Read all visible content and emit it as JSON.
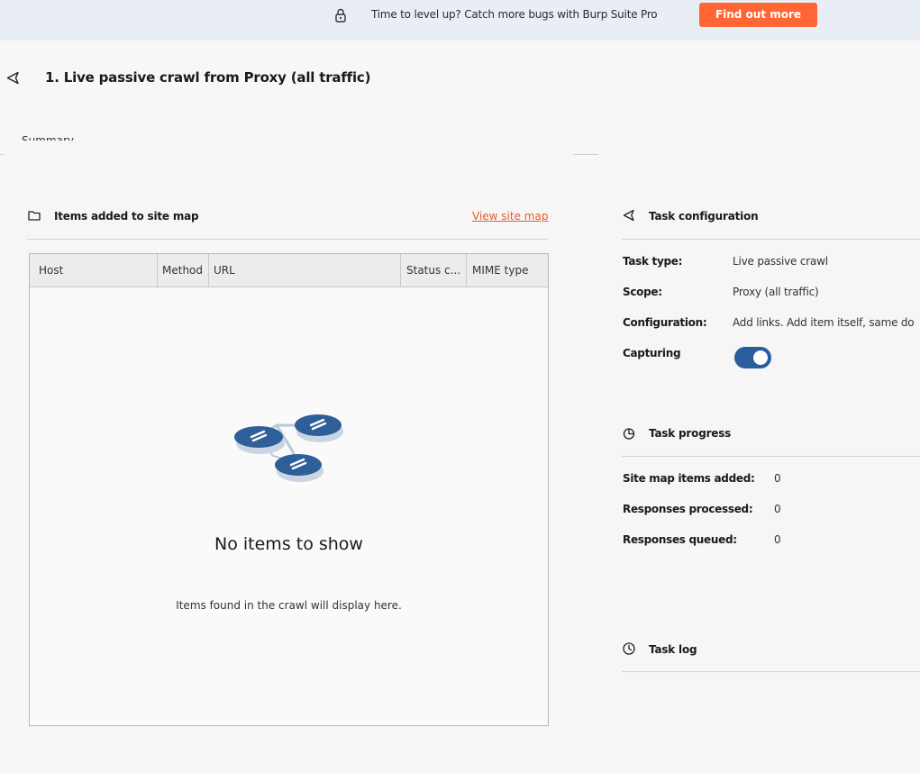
{
  "banner": {
    "message": "Time to level up? Catch more bugs with Burp Suite Pro",
    "cta_label": "Find out more"
  },
  "header": {
    "title": "1. Live passive crawl from Proxy (all traffic)"
  },
  "tabs": [
    {
      "label": "Summary",
      "active": true
    }
  ],
  "site_map_panel": {
    "title": "Items added to site map",
    "link_label": "View site map",
    "columns": [
      "Host",
      "Method",
      "URL",
      "Status c...",
      "MIME type"
    ],
    "rows": [],
    "empty_title": "No items to show",
    "empty_subtitle": "Items found in the crawl will display here."
  },
  "task_configuration": {
    "title": "Task configuration",
    "fields": [
      {
        "label": "Task type:",
        "value": "Live passive crawl"
      },
      {
        "label": "Scope:",
        "value": "Proxy (all traffic)"
      },
      {
        "label": "Configuration:",
        "value": "Add links. Add item itself, same do"
      },
      {
        "label": "Capturing",
        "value": ""
      }
    ],
    "capturing_enabled": true
  },
  "task_progress": {
    "title": "Task progress",
    "fields": [
      {
        "label": "Site map items added:",
        "value": "0"
      },
      {
        "label": "Responses processed:",
        "value": "0"
      },
      {
        "label": "Responses queued:",
        "value": "0"
      }
    ]
  },
  "task_log": {
    "title": "Task log"
  },
  "colors": {
    "accent": "#ff6633",
    "link": "#e0602e",
    "toggle_on": "#2a5d9c",
    "illustration_blue": "#2e5f99"
  }
}
